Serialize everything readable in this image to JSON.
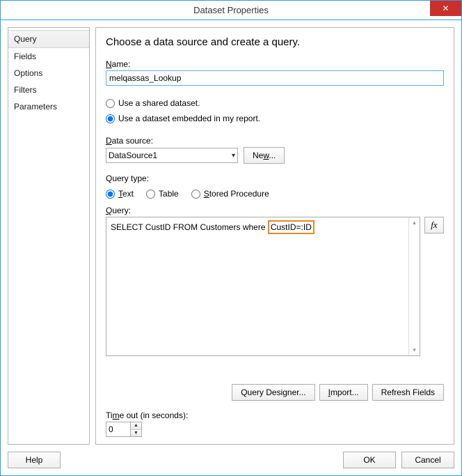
{
  "window": {
    "title": "Dataset Properties",
    "close_glyph": "✕"
  },
  "sidebar": {
    "items": [
      {
        "label": "Query",
        "active": true
      },
      {
        "label": "Fields",
        "active": false
      },
      {
        "label": "Options",
        "active": false
      },
      {
        "label": "Filters",
        "active": false
      },
      {
        "label": "Parameters",
        "active": false
      }
    ]
  },
  "main": {
    "headline": "Choose a data source and create a query.",
    "name_label": "Name:",
    "name_value": "melqassas_Lookup",
    "radio_shared": "Use a shared dataset.",
    "radio_embedded": "Use a dataset embedded in my report.",
    "datasource_label": "Data source:",
    "datasource_value": "DataSource1",
    "new_button": "New...",
    "querytype_label": "Query type:",
    "querytype_options": {
      "text": "Text",
      "table": "Table",
      "sp": "Stored Procedure"
    },
    "query_label": "Query:",
    "query_text_pre": "SELECT CustID FROM Customers where",
    "query_text_hl": "CustID=:ID",
    "fx_label": "fx",
    "designer_button": "Query Designer...",
    "import_button": "Import...",
    "refresh_button": "Refresh Fields",
    "timeout_label": "Time out (in seconds):",
    "timeout_value": "0"
  },
  "footer": {
    "help": "Help",
    "ok": "OK",
    "cancel": "Cancel"
  }
}
